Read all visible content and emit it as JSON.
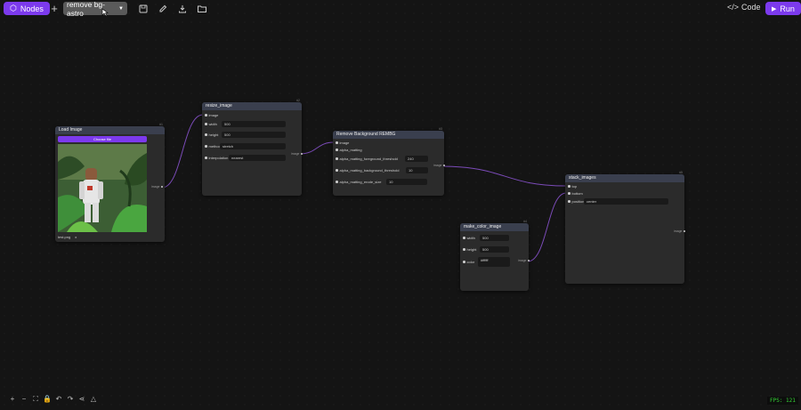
{
  "topbar": {
    "nodes_label": "Nodes",
    "add_icon": "plus-icon",
    "flow_name": "remove bg-astro",
    "code_label": "Code",
    "run_label": "Run"
  },
  "nodes": {
    "load_image": {
      "title": "Load Image",
      "id": "#1",
      "choose_label": "Choose file",
      "filename": "test.png",
      "remove": "x"
    },
    "resize_image": {
      "title": "resize_image",
      "id": "#2",
      "inputs": {
        "image": "image",
        "width_label": "width",
        "width_value": "500",
        "height_label": "height",
        "height_value": "500",
        "method_label": "method",
        "method_value": "stretch",
        "interp_label": "interpolation",
        "interp_value": "nearest"
      },
      "output": "image"
    },
    "remove_bg": {
      "title": "Remove Background REMBG",
      "id": "#3",
      "inputs": {
        "image": "image",
        "alpha_matting": "alpha_matting",
        "fg_label": "alpha_matting_foreground_threshold",
        "fg_value": "240",
        "bg_label": "alpha_matting_background_threshold",
        "bg_value": "10",
        "erode_label": "alpha_matting_erode_size",
        "erode_value": "10"
      },
      "output": "image"
    },
    "make_color_image": {
      "title": "make_color_image",
      "id": "#4",
      "inputs": {
        "width_label": "width",
        "width_value": "500",
        "height_label": "height",
        "height_value": "500",
        "color_label": "color",
        "color_value": "#ffffff"
      },
      "output": "image"
    },
    "stack_images": {
      "title": "stack_images",
      "id": "#5",
      "inputs": {
        "top": "top",
        "bottom": "bottom",
        "position_label": "position",
        "position_value": "center"
      },
      "output": "image"
    }
  },
  "status": {
    "fps": "FPS: 121"
  },
  "colors": {
    "accent": "#7c3aed",
    "header": "#3a3f4e",
    "wire": "#7b4bb8"
  }
}
